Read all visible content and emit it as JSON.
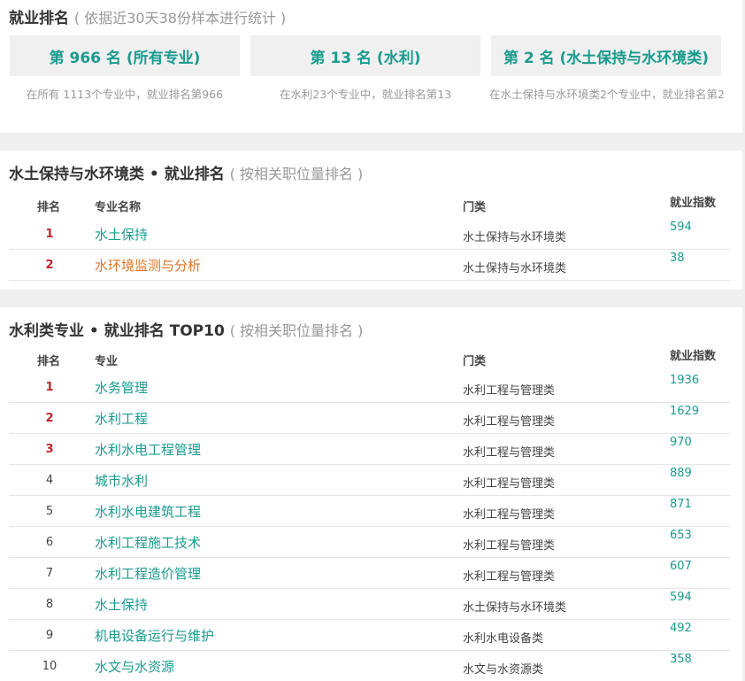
{
  "summary": {
    "title": "就业排名",
    "subtitle": "( 依据近30天38份样本进行统计 )",
    "cards": [
      {
        "label": "第 966 名 (所有专业)",
        "desc": "在所有 1113个专业中，就业排名第966"
      },
      {
        "label": "第 13 名 (水利)",
        "desc": "在水利23个专业中，就业排名第13"
      },
      {
        "label": "第 2 名 (水土保持与水环境类)",
        "desc": "在水土保持与水环境类2个专业中，就业排名第2"
      }
    ]
  },
  "section1": {
    "title": "水土保持与水环境类 • 就业排名",
    "subtitle": "( 按相关职位量排名 )",
    "headers": {
      "rank": "排名",
      "name": "专业名称",
      "category": "门类",
      "index": "就业指数"
    },
    "rows": [
      {
        "rank": "1",
        "name": "水土保持",
        "category": "水土保持与水环境类",
        "index": "594"
      },
      {
        "rank": "2",
        "name": "水环境监测与分析",
        "category": "水土保持与水环境类",
        "index": "38"
      }
    ]
  },
  "section2": {
    "title": "水利类专业 • 就业排名 TOP10",
    "subtitle": "( 按相关职位量排名 )",
    "headers": {
      "rank": "排名",
      "name": "专业",
      "category": "门类",
      "index": "就业指数"
    },
    "rows": [
      {
        "rank": "1",
        "name": "水务管理",
        "category": "水利工程与管理类",
        "index": "1936"
      },
      {
        "rank": "2",
        "name": "水利工程",
        "category": "水利工程与管理类",
        "index": "1629"
      },
      {
        "rank": "3",
        "name": "水利水电工程管理",
        "category": "水利工程与管理类",
        "index": "970"
      },
      {
        "rank": "4",
        "name": "城市水利",
        "category": "水利工程与管理类",
        "index": "889"
      },
      {
        "rank": "5",
        "name": "水利水电建筑工程",
        "category": "水利工程与管理类",
        "index": "871"
      },
      {
        "rank": "6",
        "name": "水利工程施工技术",
        "category": "水利工程与管理类",
        "index": "653"
      },
      {
        "rank": "7",
        "name": "水利工程造价管理",
        "category": "水利工程与管理类",
        "index": "607"
      },
      {
        "rank": "8",
        "name": "水土保持",
        "category": "水土保持与水环境类",
        "index": "594"
      },
      {
        "rank": "9",
        "name": "机电设备运行与维护",
        "category": "水利水电设备类",
        "index": "492"
      },
      {
        "rank": "10",
        "name": "水文与水资源",
        "category": "水文与水资源类",
        "index": "358"
      }
    ]
  }
}
